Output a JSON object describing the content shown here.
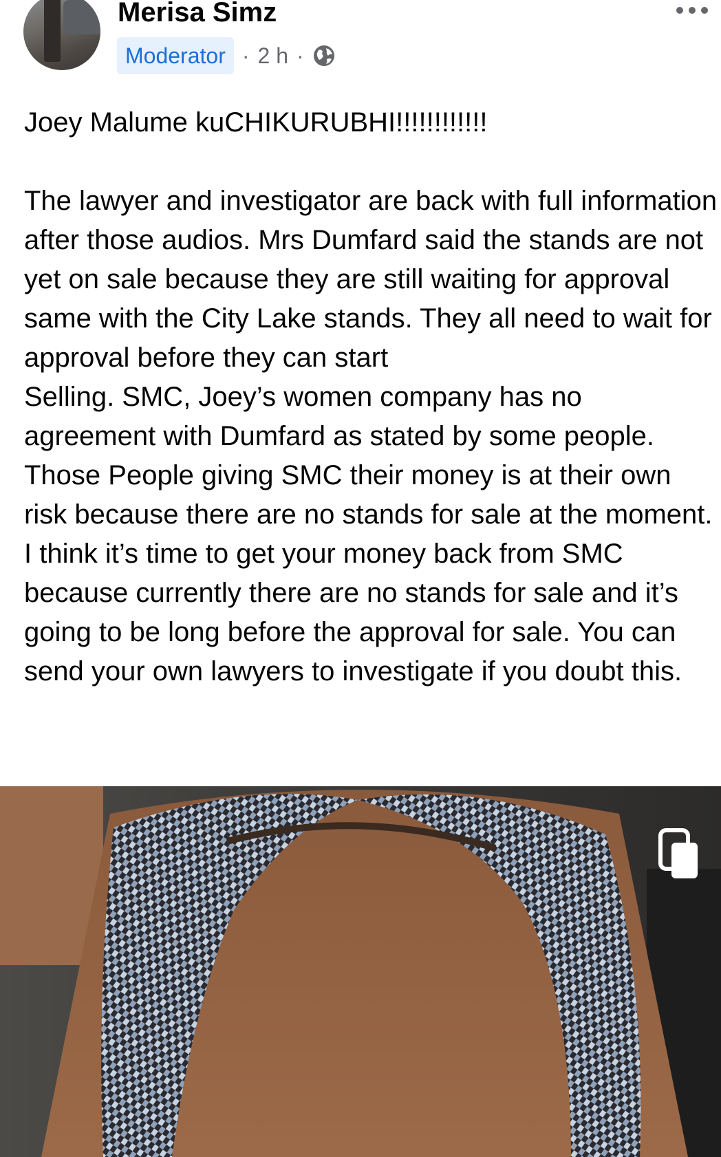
{
  "post": {
    "author_name": "Merisa Simz",
    "role_badge": "Moderator",
    "separator": "·",
    "time_ago": "2 h",
    "privacy_icon": "globe-icon",
    "more_icon": "more-horizontal-icon",
    "headline": "Joey Malume kuCHIKURUBHI!!!!!!!!!!!!",
    "body_paragraphs": [
      "The lawyer and investigator are back with full information after those audios. Mrs Dumfard said the stands are not yet on sale because they are still waiting for approval same with the City Lake stands. They all need to wait for approval before they can start\nSelling. SMC, Joey’s women company has no agreement with Dumfard as stated by some people. Those People giving SMC their money is at their own risk because there are no stands for sale at the moment. I think it’s time to get your money back from SMC because currently there are no stands for sale and it’s going to be long before the approval for sale. You can send your own lawyers to investigate if you doubt this."
    ],
    "photo_icon": "multi-photo-gallery-icon"
  },
  "colors": {
    "badge_background": "#e7f0fd",
    "badge_text": "#1b6fd8",
    "meta_text": "#65676b",
    "body_text": "#050505"
  }
}
